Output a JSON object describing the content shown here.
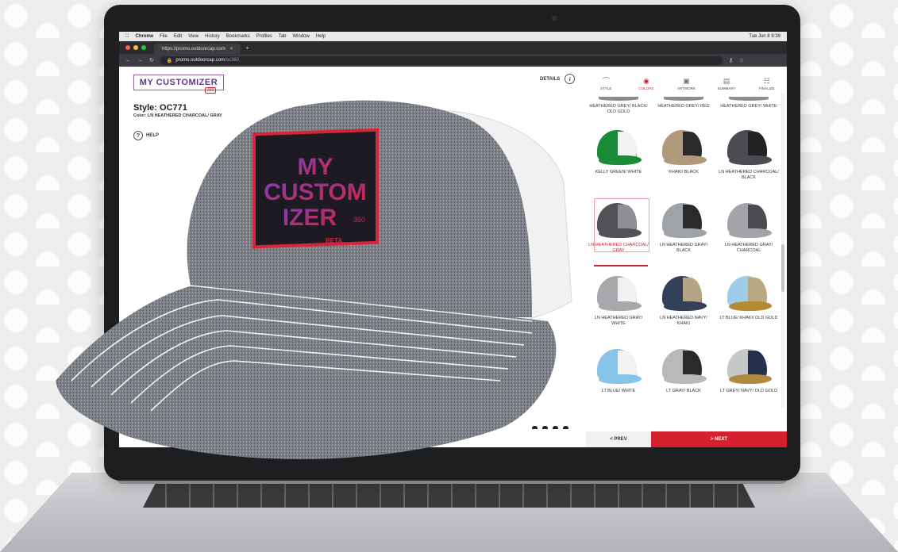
{
  "menubar": {
    "app": "Chrome",
    "items": [
      "File",
      "Edit",
      "View",
      "History",
      "Bookmarks",
      "Profiles",
      "Tab",
      "Window",
      "Help"
    ],
    "clock": "Tue Jun 8  9:39"
  },
  "browser": {
    "tab_title": "https://promo.outdoorcap.com",
    "url_host": "promo.outdoorcap.com",
    "url_path": "/oc360"
  },
  "app": {
    "logo": "MY CUSTOMIZER",
    "logo_badge": "360",
    "style_title": "Style: OC771",
    "color_line": "Color: LN HEATHERED CHARCOAL/ GRAY",
    "help": "HELP",
    "details": "DETAILS",
    "steps": [
      {
        "label": "STYLE",
        "icon": "cap-icon"
      },
      {
        "label": "COLORS",
        "icon": "palette-icon"
      },
      {
        "label": "ARTWORK",
        "icon": "image-icon"
      },
      {
        "label": "SUMMARY",
        "icon": "document-icon"
      },
      {
        "label": "FINALIZE",
        "icon": "checklist-icon"
      }
    ],
    "active_step": "COLORS",
    "prev": "< PREV",
    "next": "> NEXT"
  },
  "swatches": [
    {
      "label": "HEATHERED GREY/ BLACK/ OLD GOLD",
      "crown": "#8a8a8c",
      "mesh": "#1d1d1f",
      "brim": "#a3863e",
      "partial": true
    },
    {
      "label": "HEATHERED GREY/ RED",
      "crown": "#8d8d8f",
      "mesh": "#b41f2a",
      "brim": "#8d8d8f",
      "partial": true
    },
    {
      "label": "HEATHERED GREY/ WHITE",
      "crown": "#8e8e90",
      "mesh": "#f2f2f2",
      "brim": "#8e8e90",
      "partial": true
    },
    {
      "label": "KELLY GREEN/ WHITE",
      "crown": "#1a8a36",
      "mesh": "#f2f2f2",
      "brim": "#1a8a36"
    },
    {
      "label": "KHAKI/ BLACK",
      "crown": "#b09a7c",
      "mesh": "#2a2a2a",
      "brim": "#b09a7c"
    },
    {
      "label": "LN HEATHERED CHARCOAL/ BLACK",
      "crown": "#4a4c52",
      "mesh": "#222",
      "brim": "#4a4c52"
    },
    {
      "label": "LN HEATHERED CHARCOAL/ GRAY",
      "crown": "#505258",
      "mesh": "#8e8f93",
      "brim": "#505258",
      "selected": true
    },
    {
      "label": "LN HEATHERED GRAY/ BLACK",
      "crown": "#9fa2a6",
      "mesh": "#2a2a2a",
      "brim": "#9fa2a6"
    },
    {
      "label": "LN HEATHERED GRAY/ CHARCOAL",
      "crown": "#a2a4a8",
      "mesh": "#4a4c50",
      "brim": "#a2a4a8"
    },
    {
      "label": "LN HEATHERED GRAY/ WHITE",
      "crown": "#a7a8ab",
      "mesh": "#f1f1f1",
      "brim": "#a7a8ab"
    },
    {
      "label": "LN HEATHERED NAVY/ KHAKI",
      "crown": "#34405a",
      "mesh": "#b5a584",
      "brim": "#34405a"
    },
    {
      "label": "LT BLUE/ KHAKI/ OLD GOLD",
      "crown": "#9dcde8",
      "mesh": "#b9a883",
      "brim": "#b48a34"
    },
    {
      "label": "LT BLUE/ WHITE",
      "crown": "#86c4ea",
      "mesh": "#f2f2f2",
      "brim": "#86c4ea"
    },
    {
      "label": "LT GRAY/ BLACK",
      "crown": "#b8b9bb",
      "mesh": "#2a2a2a",
      "brim": "#b8b9bb"
    },
    {
      "label": "LT GREY/ NAVY/ OLD GOLD",
      "crown": "#c6c7c9",
      "mesh": "#26304c",
      "brim": "#b08a3e"
    }
  ],
  "patch": {
    "line1": "MY",
    "line2": "CUSTOM",
    "line3": "IZER",
    "sup": "360",
    "badge": "BETA"
  },
  "colors": {
    "accent": "#d4202f",
    "hat": "#7d8086",
    "patch_bg": "#1e1a24",
    "patch_border": "#d6243a"
  }
}
